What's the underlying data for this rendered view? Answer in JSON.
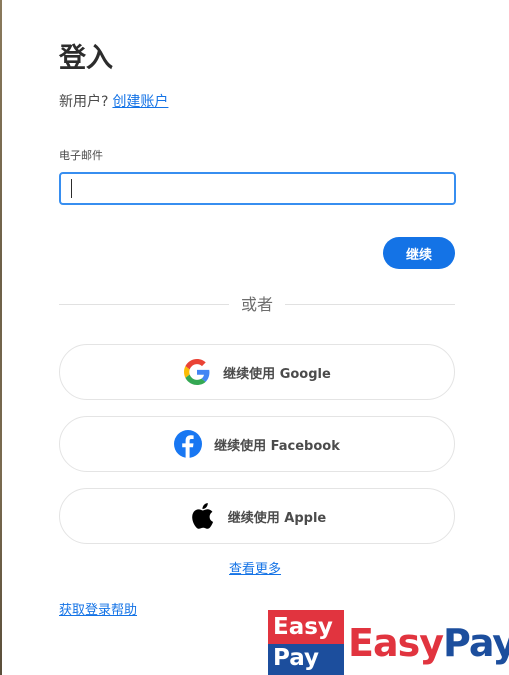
{
  "heading": "登入",
  "new_user": {
    "prompt": "新用户?",
    "create_link": "创建账户"
  },
  "email": {
    "label": "电子邮件",
    "value": "",
    "placeholder": ""
  },
  "continue_label": "继续",
  "divider_text": "或者",
  "social": {
    "google": "继续使用 Google",
    "facebook": "继续使用 Facebook",
    "apple": "继续使用 Apple"
  },
  "see_more": "查看更多",
  "help_link": "获取登录帮助",
  "watermark": {
    "logo_line1": "Easy",
    "logo_line2": "Pay",
    "text_easy": "Easy",
    "text_pay": "Pay"
  },
  "colors": {
    "accent": "#1473e6",
    "input_border": "#378ef0",
    "watermark_red": "#e1343f",
    "watermark_blue": "#1c4e9d"
  }
}
